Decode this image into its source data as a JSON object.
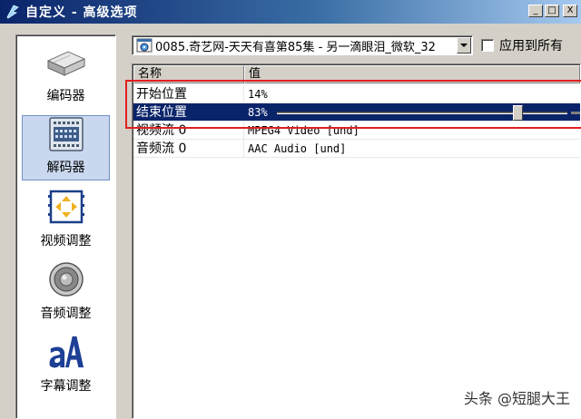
{
  "window": {
    "title": "自定义 - 高级选项",
    "buttons": {
      "minimize": "_",
      "maximize": "□",
      "close": "X"
    }
  },
  "sidebar": {
    "items": [
      {
        "label": "编码器",
        "icon": "encoder-icon",
        "selected": false
      },
      {
        "label": "解码器",
        "icon": "decoder-icon",
        "selected": true
      },
      {
        "label": "视频调整",
        "icon": "video-adjust-icon",
        "selected": false
      },
      {
        "label": "音频调整",
        "icon": "audio-adjust-icon",
        "selected": false
      },
      {
        "label": "字幕调整",
        "icon": "subtitle-adjust-icon",
        "selected": false
      }
    ]
  },
  "source": {
    "selected": "0085.奇艺网-天天有喜第85集 - 另一滴眼泪_微软_32"
  },
  "apply_all": {
    "label": "应用到所有",
    "checked": false
  },
  "grid": {
    "columns": [
      "名称",
      "值"
    ],
    "rows": [
      {
        "name": "开始位置",
        "value": "14%"
      },
      {
        "name": "结束位置",
        "value": "83%",
        "slider": 0.83,
        "selected": true
      },
      {
        "name": "视频流 0",
        "value": "MPEG4 Video [und]"
      },
      {
        "name": "音频流 0",
        "value": "AAC Audio [und]"
      }
    ]
  },
  "watermark": "头条 @短腿大王",
  "colors": {
    "selection": "#0a246a",
    "highlight_box": "#e02020",
    "title_bar": "#0a246a"
  }
}
